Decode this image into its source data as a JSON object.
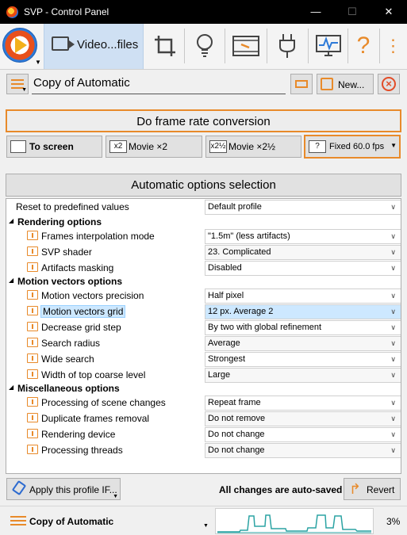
{
  "window": {
    "title": "SVP - Control Panel",
    "minimize_glyph": "—",
    "maximize_glyph": "☐",
    "close_glyph": "✕"
  },
  "toolbar": {
    "active_tab_label": "Video...files",
    "icons": [
      "svp-logo-icon",
      "video-camera-icon",
      "crop-icon",
      "lightbulb-icon",
      "film-icon",
      "plug-icon",
      "monitor-icon",
      "help-icon",
      "more-icon"
    ],
    "help_glyph": "?",
    "more_glyph": "⋮"
  },
  "profile": {
    "name": "Copy of Automatic",
    "new_label": "New..."
  },
  "frame_rate": {
    "conversion_label": "Do frame rate conversion",
    "options": [
      {
        "label": "To screen",
        "icon_text": ""
      },
      {
        "label": "Movie ×2",
        "icon_text": "x2"
      },
      {
        "label": "Movie ×2½",
        "icon_text": "x2½"
      },
      {
        "label": "Fixed 60.0 fps",
        "icon_text": "?"
      }
    ]
  },
  "options": {
    "header": "Automatic options selection",
    "reset_label": "Reset to predefined values",
    "reset_value": "Default profile",
    "sections": [
      {
        "title": "Rendering options",
        "rows": [
          {
            "label": "Frames interpolation mode",
            "value": "\"1.5m\" (less artifacts)"
          },
          {
            "label": "SVP shader",
            "value": "23. Complicated"
          },
          {
            "label": "Artifacts masking",
            "value": "Disabled"
          }
        ]
      },
      {
        "title": "Motion vectors options",
        "rows": [
          {
            "label": "Motion vectors precision",
            "value": "Half pixel"
          },
          {
            "label": "Motion vectors grid",
            "value": "12 px. Average 2"
          },
          {
            "label": "Decrease grid step",
            "value": "By two with global refinement"
          },
          {
            "label": "Search radius",
            "value": "Average"
          },
          {
            "label": "Wide search",
            "value": "Strongest"
          },
          {
            "label": "Width of top coarse level",
            "value": "Large"
          }
        ]
      },
      {
        "title": "Miscellaneous options",
        "rows": [
          {
            "label": "Processing of scene changes",
            "value": "Repeat frame"
          },
          {
            "label": "Duplicate frames removal",
            "value": "Do not remove"
          },
          {
            "label": "Rendering device",
            "value": "Do not change"
          },
          {
            "label": "Processing threads",
            "value": "Do not change"
          }
        ]
      }
    ]
  },
  "footer": {
    "apply_label": "Apply this profile IF...",
    "autosaved_text": "All changes are auto-saved",
    "revert_label": "Revert"
  },
  "status": {
    "profile_name": "Copy of Automatic",
    "cpu_load": "3%",
    "accent_color": "#e88a2a",
    "graph_color": "#2ba3a3"
  }
}
